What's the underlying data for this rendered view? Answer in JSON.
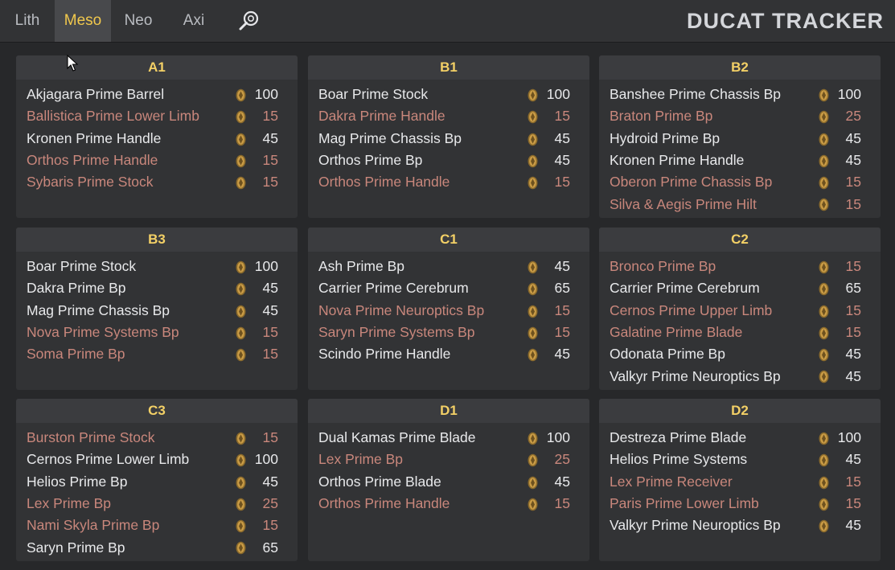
{
  "app": {
    "brand": "DUCAT TRACKER",
    "tabs": [
      {
        "label": "Lith",
        "active": false
      },
      {
        "label": "Meso",
        "active": true
      },
      {
        "label": "Neo",
        "active": false
      },
      {
        "label": "Axi",
        "active": false
      }
    ],
    "search_icon": "search-icon",
    "colors": {
      "accent": "#f1c84c",
      "normal_text": "#e8e9eb",
      "low_value_text": "#c9877c",
      "card_bg": "#323335",
      "page_bg": "#27282a"
    }
  },
  "relics": [
    {
      "name": "A1",
      "items": [
        {
          "name": "Akjagara Prime Barrel",
          "ducats": "100",
          "low": false
        },
        {
          "name": "Ballistica Prime Lower Limb",
          "ducats": "15",
          "low": true
        },
        {
          "name": "Kronen Prime Handle",
          "ducats": "45",
          "low": false
        },
        {
          "name": "Orthos Prime Handle",
          "ducats": "15",
          "low": true
        },
        {
          "name": "Sybaris Prime Stock",
          "ducats": "15",
          "low": true
        }
      ]
    },
    {
      "name": "B1",
      "items": [
        {
          "name": "Boar Prime Stock",
          "ducats": "100",
          "low": false
        },
        {
          "name": "Dakra Prime Handle",
          "ducats": "15",
          "low": true
        },
        {
          "name": "Mag Prime Chassis Bp",
          "ducats": "45",
          "low": false
        },
        {
          "name": "Orthos Prime Bp",
          "ducats": "45",
          "low": false
        },
        {
          "name": "Orthos Prime Handle",
          "ducats": "15",
          "low": true
        }
      ]
    },
    {
      "name": "B2",
      "items": [
        {
          "name": "Banshee Prime Chassis Bp",
          "ducats": "100",
          "low": false
        },
        {
          "name": "Braton Prime Bp",
          "ducats": "25",
          "low": true
        },
        {
          "name": "Hydroid Prime Bp",
          "ducats": "45",
          "low": false
        },
        {
          "name": "Kronen Prime Handle",
          "ducats": "45",
          "low": false
        },
        {
          "name": "Oberon Prime Chassis Bp",
          "ducats": "15",
          "low": true
        },
        {
          "name": "Silva & Aegis Prime Hilt",
          "ducats": "15",
          "low": true
        }
      ]
    },
    {
      "name": "B3",
      "items": [
        {
          "name": "Boar Prime Stock",
          "ducats": "100",
          "low": false
        },
        {
          "name": "Dakra Prime Bp",
          "ducats": "45",
          "low": false
        },
        {
          "name": "Mag Prime Chassis Bp",
          "ducats": "45",
          "low": false
        },
        {
          "name": "Nova Prime Systems Bp",
          "ducats": "15",
          "low": true
        },
        {
          "name": "Soma Prime Bp",
          "ducats": "15",
          "low": true
        }
      ]
    },
    {
      "name": "C1",
      "items": [
        {
          "name": "Ash Prime Bp",
          "ducats": "45",
          "low": false
        },
        {
          "name": "Carrier Prime Cerebrum",
          "ducats": "65",
          "low": false
        },
        {
          "name": "Nova Prime Neuroptics Bp",
          "ducats": "15",
          "low": true
        },
        {
          "name": "Saryn Prime Systems Bp",
          "ducats": "15",
          "low": true
        },
        {
          "name": "Scindo Prime Handle",
          "ducats": "45",
          "low": false
        }
      ]
    },
    {
      "name": "C2",
      "items": [
        {
          "name": "Bronco Prime Bp",
          "ducats": "15",
          "low": true
        },
        {
          "name": "Carrier Prime Cerebrum",
          "ducats": "65",
          "low": false
        },
        {
          "name": "Cernos Prime Upper Limb",
          "ducats": "15",
          "low": true
        },
        {
          "name": "Galatine Prime Blade",
          "ducats": "15",
          "low": true
        },
        {
          "name": "Odonata Prime Bp",
          "ducats": "45",
          "low": false
        },
        {
          "name": "Valkyr Prime Neuroptics Bp",
          "ducats": "45",
          "low": false
        }
      ]
    },
    {
      "name": "C3",
      "items": [
        {
          "name": "Burston Prime Stock",
          "ducats": "15",
          "low": true
        },
        {
          "name": "Cernos Prime Lower Limb",
          "ducats": "100",
          "low": false
        },
        {
          "name": "Helios Prime Bp",
          "ducats": "45",
          "low": false
        },
        {
          "name": "Lex Prime Bp",
          "ducats": "25",
          "low": true
        },
        {
          "name": "Nami Skyla Prime Bp",
          "ducats": "15",
          "low": true
        },
        {
          "name": "Saryn Prime Bp",
          "ducats": "65",
          "low": false
        }
      ]
    },
    {
      "name": "D1",
      "items": [
        {
          "name": "Dual Kamas Prime Blade",
          "ducats": "100",
          "low": false
        },
        {
          "name": "Lex Prime Bp",
          "ducats": "25",
          "low": true
        },
        {
          "name": "Orthos Prime Blade",
          "ducats": "45",
          "low": false
        },
        {
          "name": "Orthos Prime Handle",
          "ducats": "15",
          "low": true
        }
      ]
    },
    {
      "name": "D2",
      "items": [
        {
          "name": "Destreza Prime Blade",
          "ducats": "100",
          "low": false
        },
        {
          "name": "Helios Prime Systems",
          "ducats": "45",
          "low": false
        },
        {
          "name": "Lex Prime Receiver",
          "ducats": "15",
          "low": true
        },
        {
          "name": "Paris Prime Lower Limb",
          "ducats": "15",
          "low": true
        },
        {
          "name": "Valkyr Prime Neuroptics Bp",
          "ducats": "45",
          "low": false
        }
      ]
    }
  ]
}
